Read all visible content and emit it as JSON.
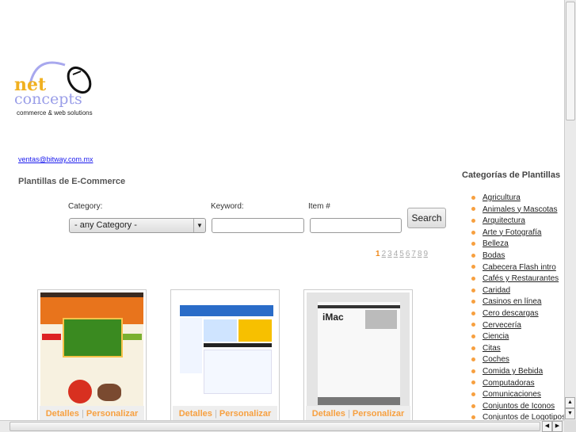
{
  "logo": {
    "net": "net",
    "concepts": "concepts",
    "tagline": "commerce & web solutions"
  },
  "email": "ventas@bitway.com.mx",
  "title": "Plantillas de E-Commerce",
  "form": {
    "category_label": "Category:",
    "category_value": "- any Category -",
    "keyword_label": "Keyword:",
    "keyword_value": "",
    "item_label": "Item #",
    "item_value": "",
    "search_label": "Search"
  },
  "pagination": {
    "current": "1",
    "pages": [
      "2",
      "3",
      "4",
      "5",
      "6",
      "7",
      "8",
      "9"
    ]
  },
  "cards": [
    {
      "details": "Detalles",
      "sep": "|",
      "customize": "Personalizar",
      "colors": [
        "#e8741c",
        "#f7c24a",
        "#3a8a20"
      ]
    },
    {
      "details": "Detalles",
      "sep": "|",
      "customize": "Personalizar",
      "colors": [
        "#2a6cc8",
        "#f4f8ff",
        "#f7c000"
      ]
    },
    {
      "details": "Detalles",
      "sep": "|",
      "customize": "Personalizar",
      "colors": [
        "#555",
        "#f2f2f2",
        "#999"
      ]
    }
  ],
  "sidebar": {
    "heading": "Categorías de Plantillas",
    "items": [
      "Agricultura",
      "Animales y Mascotas",
      "Arquitectura",
      "Arte y Fotografía",
      "Belleza",
      "Bodas",
      "Cabecera Flash intro",
      "Cafés y Restaurantes",
      "Caridad",
      "Casinos en línea",
      "Cero descargas",
      "Cervecería",
      "Ciencia",
      "Citas",
      "Coches",
      "Comida y Bebida",
      "Computadoras",
      "Comunicaciones",
      "Conjuntos de Iconos",
      "Conjuntos de Logotipos"
    ]
  }
}
